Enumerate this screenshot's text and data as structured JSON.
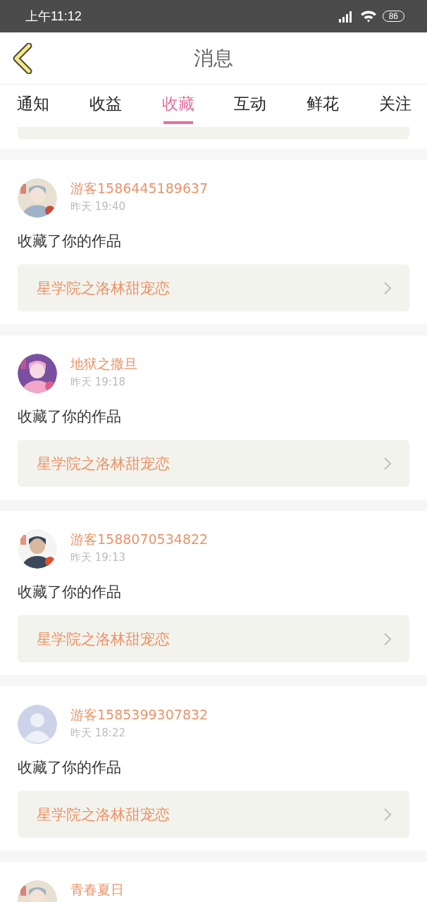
{
  "status_bar": {
    "time": "上午11:12",
    "battery": "86"
  },
  "header": {
    "title": "消息"
  },
  "tabs": [
    {
      "label": "通知",
      "selected": false
    },
    {
      "label": "收益",
      "selected": false
    },
    {
      "label": "收藏",
      "selected": true
    },
    {
      "label": "互动",
      "selected": false
    },
    {
      "label": "鲜花",
      "selected": false
    },
    {
      "label": "关注",
      "selected": false
    }
  ],
  "messages": [
    {
      "kind": "picture",
      "name": "游客1586445189637",
      "time": "昨天 19:40",
      "text": "收藏了你的作品",
      "work": "星学院之洛林甜宠恋"
    },
    {
      "kind": "picture",
      "name": "地狱之撒旦",
      "time": "昨天 19:18",
      "text": "收藏了你的作品",
      "work": "星学院之洛林甜宠恋"
    },
    {
      "kind": "picture",
      "name": "游客1588070534822",
      "time": "昨天 19:13",
      "text": "收藏了你的作品",
      "work": "星学院之洛林甜宠恋"
    },
    {
      "kind": "default",
      "name": "游客1585399307832",
      "time": "昨天 18:22",
      "text": "收藏了你的作品",
      "work": "星学院之洛林甜宠恋"
    },
    {
      "kind": "picture",
      "name": "青春夏日"
    }
  ]
}
